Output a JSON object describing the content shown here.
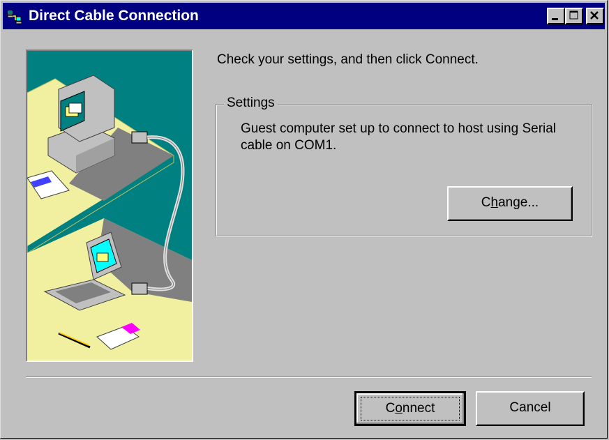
{
  "window": {
    "title": "Direct Cable Connection",
    "titlebar_color": "#000080"
  },
  "main": {
    "instruction": "Check your settings, and then click Connect.",
    "settings_group": {
      "label": "Settings",
      "description": "Guest computer set up to connect to host using Serial cable on COM1.",
      "change_button": {
        "accel": "h",
        "pre": "C",
        "post": "ange..."
      }
    }
  },
  "footer": {
    "connect_button": {
      "pre": "C",
      "accel": "o",
      "post": "nnect"
    },
    "cancel_label": "Cancel"
  }
}
